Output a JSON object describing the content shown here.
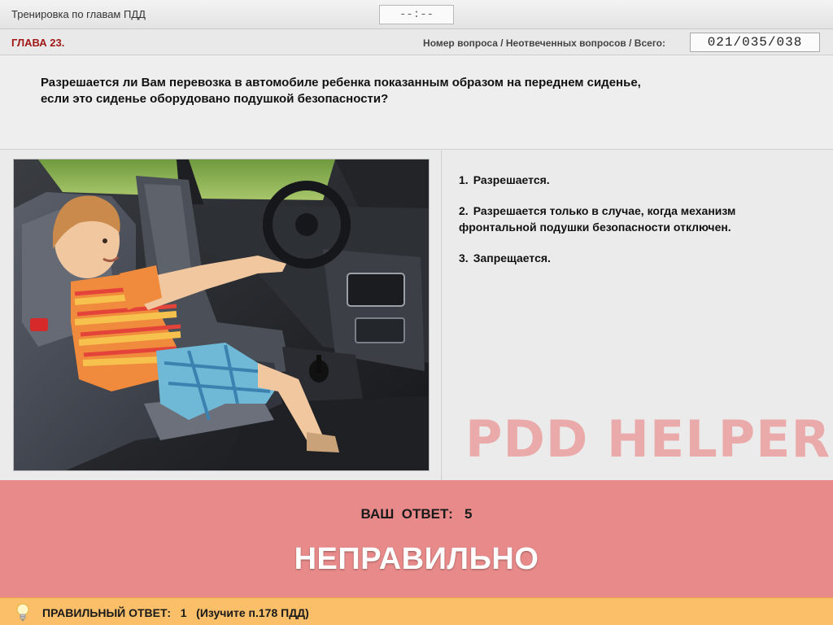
{
  "app": {
    "title": "Тренировка по главам ПДД",
    "timer": "--:--"
  },
  "info": {
    "chapter": "ГЛАВА 23.",
    "counter_label": "Номер вопроса / Неотвеченных вопросов / Всего:",
    "counter_value": "021/035/038"
  },
  "question": {
    "text_line1": "Разрешается ли Вам перевозка в автомобиле ребенка показанным образом на переднем сиденье,",
    "text_line2": "если это сиденье оборудовано подушкой безопасности?"
  },
  "answers": [
    {
      "num": "1.",
      "text": "Разрешается."
    },
    {
      "num": "2.",
      "text": "Разрешается только в случае, когда механизм фронтальной подушки безопасности отключен."
    },
    {
      "num": "3.",
      "text": "Запрещается."
    }
  ],
  "watermark": "PDD HELPER",
  "result": {
    "your_answer_label": "ВАШ  ОТВЕТ:",
    "your_answer_value": "5",
    "verdict": "НЕПРАВИЛЬНО",
    "background": "#e88a8a"
  },
  "hint": {
    "icon": "lightbulb-icon",
    "text": "ПРАВИЛЬНЫЙ ОТВЕТ:   1   (Изучите п.178 ПДД)",
    "background": "#fbbf6a"
  }
}
